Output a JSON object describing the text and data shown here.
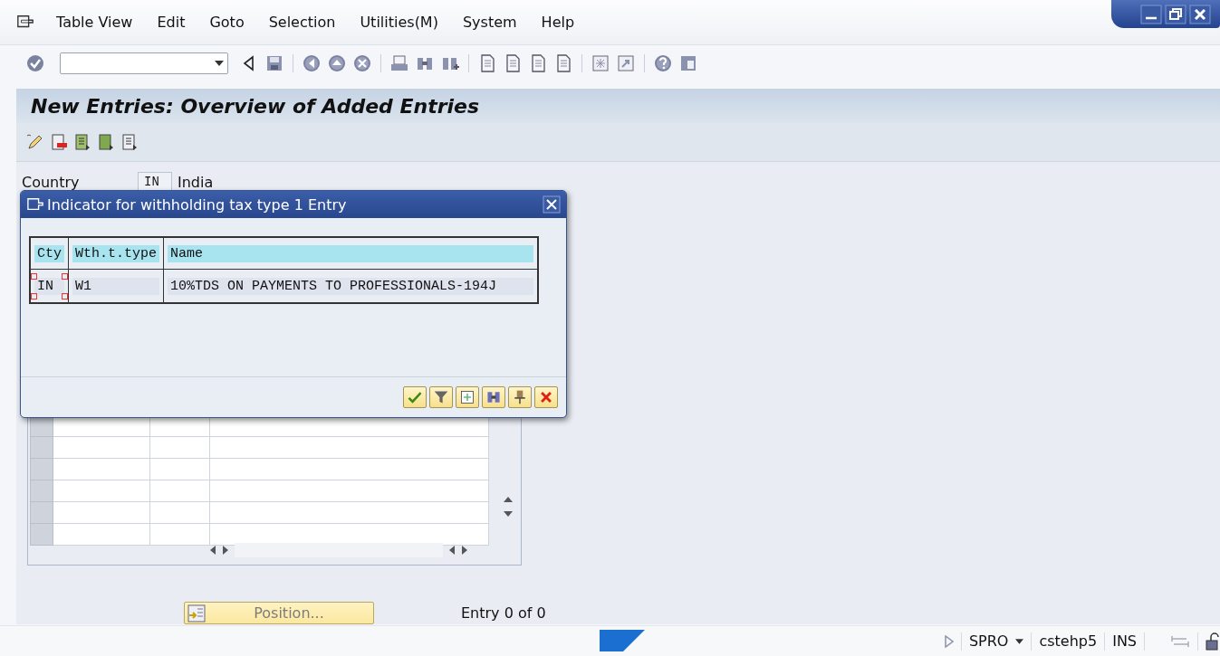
{
  "menu": [
    {
      "label": "Table View"
    },
    {
      "label": "Edit"
    },
    {
      "label": "Goto"
    },
    {
      "label": "Selection"
    },
    {
      "label": "Utilities(M)"
    },
    {
      "label": "System"
    },
    {
      "label": "Help"
    }
  ],
  "screen": {
    "title": "New Entries: Overview of Added Entries"
  },
  "country": {
    "label": "Country",
    "code": "IN",
    "name": "India"
  },
  "dialog": {
    "title": "Indicator for withholding tax type 1 Entry",
    "table": {
      "columns": [
        "Cty",
        "Wth.t.type",
        "Name"
      ],
      "rows": [
        {
          "cty": "IN",
          "type": "W1",
          "name": "10%TDS ON PAYMENTS TO PROFESSIONALS-194J"
        }
      ]
    }
  },
  "position_button": {
    "label": "Position..."
  },
  "entry_counter": "Entry 0 of 0",
  "status_bar": {
    "transaction": "SPRO",
    "server": "cstehp5",
    "mode": "INS"
  }
}
